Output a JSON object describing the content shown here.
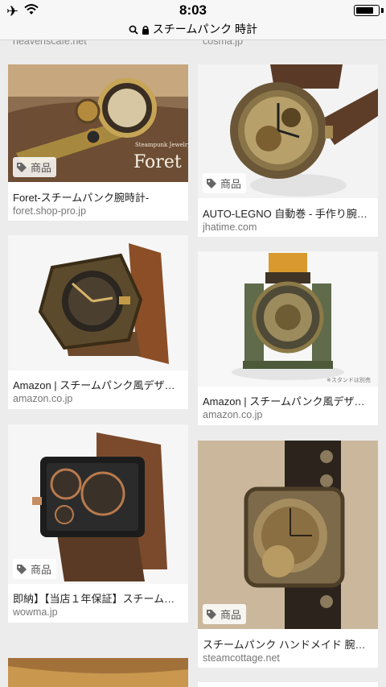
{
  "status": {
    "time": "8:03",
    "battery_level": 0.85
  },
  "url": {
    "text": "スチームパンク 時計"
  },
  "top_partial": {
    "left_domain": "heavenscafe.net",
    "right_domain": "cosma.jp"
  },
  "results": [
    {
      "caption": "Foret-スチームパンク腕時計-",
      "domain": "foret.shop-pro.jp",
      "badge": "商品",
      "watermark_small": "Steampunk Jewelry",
      "watermark_big": "Foret"
    },
    {
      "caption": "AUTO-LEGNO 自動巻 - 手作り腕…",
      "domain": "jhatime.com",
      "badge": "商品"
    },
    {
      "caption": "Amazon | スチームパンク風デザイ…",
      "domain": "amazon.co.jp"
    },
    {
      "caption": "Amazon | スチームパンク風デザ…",
      "domain": "amazon.co.jp",
      "note": "※スタンドは別売"
    },
    {
      "caption": "即納】【当店１年保証】スチーム…",
      "domain": "wowma.jp",
      "badge": "商品"
    },
    {
      "caption": "スチームパンク ハンドメイド 腕…",
      "domain": "steamcottage.net",
      "badge": "商品"
    }
  ]
}
